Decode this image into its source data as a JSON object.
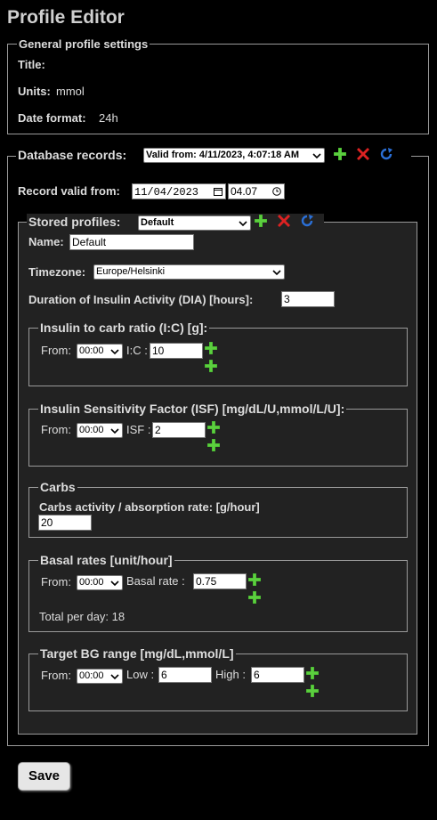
{
  "page": {
    "title": "Profile Editor"
  },
  "general": {
    "legend": "General profile settings",
    "title_label": "Title:",
    "title_value": "",
    "units_label": "Units:",
    "units_value": "mmol",
    "date_format_label": "Date format:",
    "date_format_value": "24h"
  },
  "database": {
    "legend": "Database records:",
    "record_select": "Valid from: 4/11/2023, 4:07:18 AM",
    "record_valid_from_label": "Record valid from:",
    "date_value": "11/04/2023",
    "time_value": "04.07"
  },
  "stored": {
    "legend": "Stored profiles:",
    "profile_select": "Default",
    "name_label": "Name:",
    "name_value": "Default",
    "timezone_label": "Timezone:",
    "timezone_value": "Europe/Helsinki",
    "dia_label": "Duration of Insulin Activity (DIA) [hours]:",
    "dia_value": "3"
  },
  "ic": {
    "legend": "Insulin to carb ratio (I:C) [g]:",
    "from_label": "From:",
    "from_value": "00:00",
    "ratio_label": "I:C :",
    "ratio_value": "10"
  },
  "isf": {
    "legend": "Insulin Sensitivity Factor (ISF) [mg/dL/U,mmol/L/U]:",
    "from_label": "From:",
    "from_value": "00:00",
    "isf_label": "ISF :",
    "isf_value": "2"
  },
  "carbs": {
    "legend": "Carbs",
    "rate_label": "Carbs activity / absorption rate: [g/hour]",
    "rate_value": "20"
  },
  "basal": {
    "legend": "Basal rates [unit/hour]",
    "from_label": "From:",
    "from_value": "00:00",
    "rate_label": "Basal rate :",
    "rate_value": "0.75",
    "total_label": "Total per day: 18"
  },
  "target": {
    "legend": "Target BG range [mg/dL,mmol/L]",
    "from_label": "From:",
    "from_value": "00:00",
    "low_label": "Low :",
    "low_value": "6",
    "high_label": "High :",
    "high_value": "6"
  },
  "actions": {
    "save_label": "Save"
  },
  "colors": {
    "add_icon": "#3fae2a",
    "remove_icon": "#d22",
    "reload_icon": "#2a6fd6",
    "panel_bg": "#222222",
    "border": "#9a9a9a"
  },
  "icons": [
    "plus-icon",
    "cross-icon",
    "reload-icon",
    "chevron-down-icon",
    "calendar-icon",
    "clock-icon"
  ]
}
